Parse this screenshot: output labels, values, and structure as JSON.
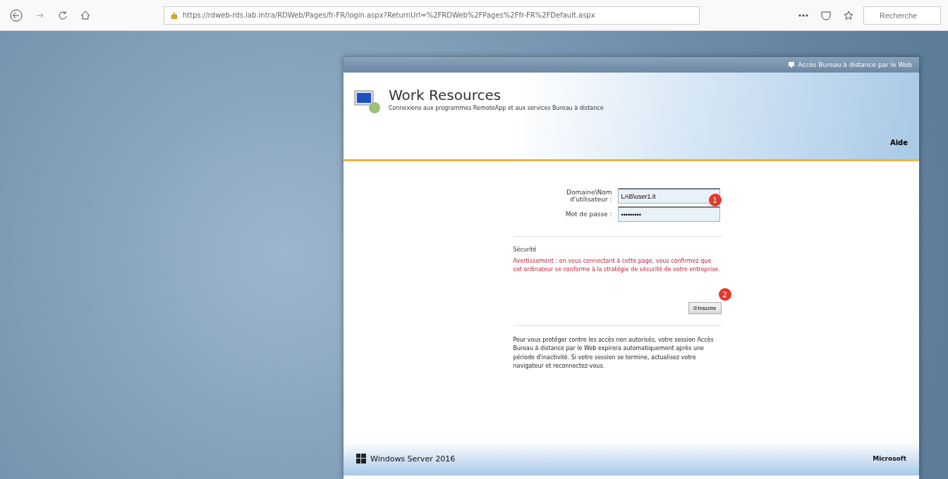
{
  "browser": {
    "url": "https://rdweb-rds.lab.intra/RDWeb/Pages/fr-FR/login.aspx?ReturnUrl=%2FRDWeb%2FPages%2Ffr-FR%2FDefault.aspx",
    "search_placeholder": "Recherche"
  },
  "portal": {
    "top_link": "Accès Bureau à distance par le Web",
    "title": "Work Resources",
    "subtitle": "Connexions aux programmes RemoteApp et aux services Bureau à distance",
    "help": "Aide",
    "fields": [
      {
        "label": "Domaine\\Nom d'utilisateur :",
        "value": "LAB\\user1.it"
      },
      {
        "label": "Mot de passe :",
        "value": "•••••••••"
      }
    ],
    "security_heading": "Sécurité",
    "warning": "Avertissement : en vous connectant à cette page, vous confirmez que cet ordinateur se conforme à la stratégie de sécurité de votre entreprise.",
    "signin_button": "S'inscrire",
    "notice": "Pour vous protéger contre les accès non autorisés, votre session Accès Bureau à distance par le Web expirera automatiquement après une période d'inactivité. Si votre session se termine, actualisez votre navigateur et reconnectez-vous.",
    "footer_product": "Windows Server 2016",
    "footer_brand": "Microsoft"
  },
  "annotations": [
    "1",
    "2"
  ]
}
